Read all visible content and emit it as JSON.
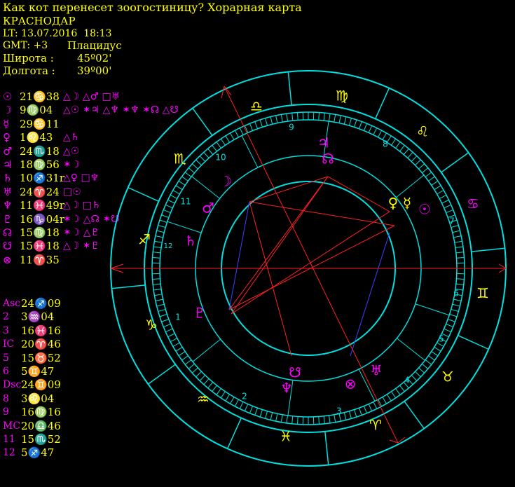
{
  "header": {
    "title": "Как кот перенесет зоогостиницу? Хорарная карта",
    "city": "КРАСНОДАР",
    "local_time": "LT: 13.07.2016  18:13",
    "gmt": "GMT: +3",
    "house_system": "Плацидус",
    "latitude_label": "Широта :",
    "latitude_value": "45º02'",
    "longitude_label": "Долгота :",
    "longitude_value": "39º00'"
  },
  "planets": [
    {
      "symbol": "☉",
      "position": "21♋38",
      "aspects": "△☽ △♂ □♅"
    },
    {
      "symbol": "☽",
      "position": "9♍04",
      "aspects": "△☉ ✶♃ △♆ ✶♆ ✶☊ △☋"
    },
    {
      "symbol": "☿",
      "position": "29♋11",
      "aspects": ""
    },
    {
      "symbol": "♀",
      "position": "1♌43",
      "aspects": "△♄"
    },
    {
      "symbol": "♂",
      "position": "24♏18",
      "aspects": "△☉"
    },
    {
      "symbol": "♃",
      "position": "18♍56",
      "aspects": "✶☽"
    },
    {
      "symbol": "♄",
      "position": "10♐31r",
      "aspects": "△♀ □♆"
    },
    {
      "symbol": "♅",
      "position": "24♈24",
      "aspects": "□☉"
    },
    {
      "symbol": "♆",
      "position": "11♓49r",
      "aspects": "△☽ □♄"
    },
    {
      "symbol": "♇",
      "position": "16♑04r",
      "aspects": "✶☽ △☊ ✶☋"
    },
    {
      "symbol": "☊",
      "position": "15♍18",
      "aspects": "✶☽ △♇"
    },
    {
      "symbol": "☋",
      "position": "15♓18",
      "aspects": "△☽ ✶♇"
    },
    {
      "symbol": "⊗",
      "position": "11♈35",
      "aspects": ""
    }
  ],
  "cusps": [
    {
      "label": "Asc",
      "value": "24♐09"
    },
    {
      "label": "2",
      "value": "3♒04"
    },
    {
      "label": "3",
      "value": "16♓16"
    },
    {
      "label": "IC",
      "value": "20♈46"
    },
    {
      "label": "5",
      "value": "15♉52"
    },
    {
      "label": "6",
      "value": "5♊47"
    },
    {
      "label": "Dsc",
      "value": "24♊09"
    },
    {
      "label": "8",
      "value": "3♌04"
    },
    {
      "label": "9",
      "value": "16♍16"
    },
    {
      "label": "MC",
      "value": "20♎46"
    },
    {
      "label": "11",
      "value": "15♏52"
    },
    {
      "label": "12",
      "value": "5♐47"
    }
  ],
  "wheel": {
    "zodiac_signs": [
      {
        "sign": "♎",
        "color": "#ffff00"
      },
      {
        "sign": "♍",
        "color": "#ffff00"
      },
      {
        "sign": "♌",
        "color": "#ffff00"
      },
      {
        "sign": "♋",
        "color": "#ff00ff"
      },
      {
        "sign": "♊",
        "color": "#ffff00"
      },
      {
        "sign": "♉",
        "color": "#ffff00"
      },
      {
        "sign": "♈",
        "color": "#ffff00"
      },
      {
        "sign": "♓",
        "color": "#ffff00"
      },
      {
        "sign": "♒",
        "color": "#ffff00"
      },
      {
        "sign": "♑",
        "color": "#ffff00"
      },
      {
        "sign": "♐",
        "color": "#ffff00"
      },
      {
        "sign": "♏",
        "color": "#ffff00"
      }
    ],
    "house_numbers": [
      "1",
      "2",
      "3",
      "4",
      "5",
      "6",
      "7",
      "8",
      "9",
      "10",
      "11",
      "12"
    ],
    "planets_in_wheel": [
      {
        "symbol": "♃",
        "color": "#ff00ff"
      },
      {
        "symbol": "☊",
        "color": "#ff00ff"
      },
      {
        "symbol": "☽",
        "color": "#ff00ff"
      },
      {
        "symbol": "♂",
        "color": "#ff00ff"
      },
      {
        "symbol": "♄",
        "color": "#ff00ff"
      },
      {
        "symbol": "♀",
        "color": "#ffff00"
      },
      {
        "symbol": "☿",
        "color": "#ffff00"
      },
      {
        "symbol": "☉",
        "color": "#ff00ff"
      },
      {
        "symbol": "♇",
        "color": "#ff00ff"
      },
      {
        "symbol": "☋",
        "color": "#ff00ff"
      },
      {
        "symbol": "♆",
        "color": "#ff00ff"
      },
      {
        "symbol": "⊗",
        "color": "#ff00ff"
      },
      {
        "symbol": "♅",
        "color": "#ff00ff"
      }
    ],
    "colors": {
      "ring": "#00e0e0",
      "axis": "#ff2020",
      "glyph_planet": "#ff00ff",
      "glyph_sign": "#ffff00"
    }
  }
}
